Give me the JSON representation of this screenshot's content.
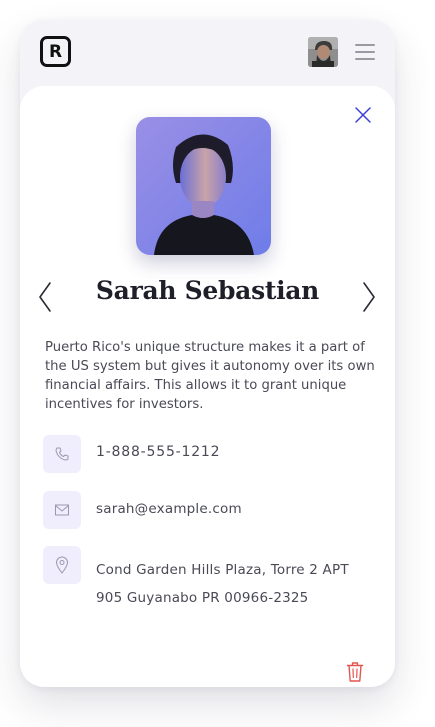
{
  "header": {
    "logo_letter": "R",
    "icons": {
      "logo": "brand-logo-icon",
      "menu": "hamburger-menu-icon",
      "avatar": "user-avatar"
    }
  },
  "profile": {
    "name": "Sarah Sebastian",
    "bio": "Puerto Rico's unique structure makes it a part of the US system but gives it autonomy over its own financial affairs. This allows it to grant unique incentives for investors.",
    "phone": "1-888-555-1212",
    "email": "sarah@example.com",
    "address_line1": "Cond Garden Hills Plaza, Torre 2 APT",
    "address_line2": "905 Guyanabo PR 00966-2325"
  },
  "colors": {
    "accent": "#3d3fd8",
    "danger": "#e2554f",
    "icon_bg": "#f0eefc",
    "text": "#4a4a56",
    "heading": "#1f1f2a"
  }
}
